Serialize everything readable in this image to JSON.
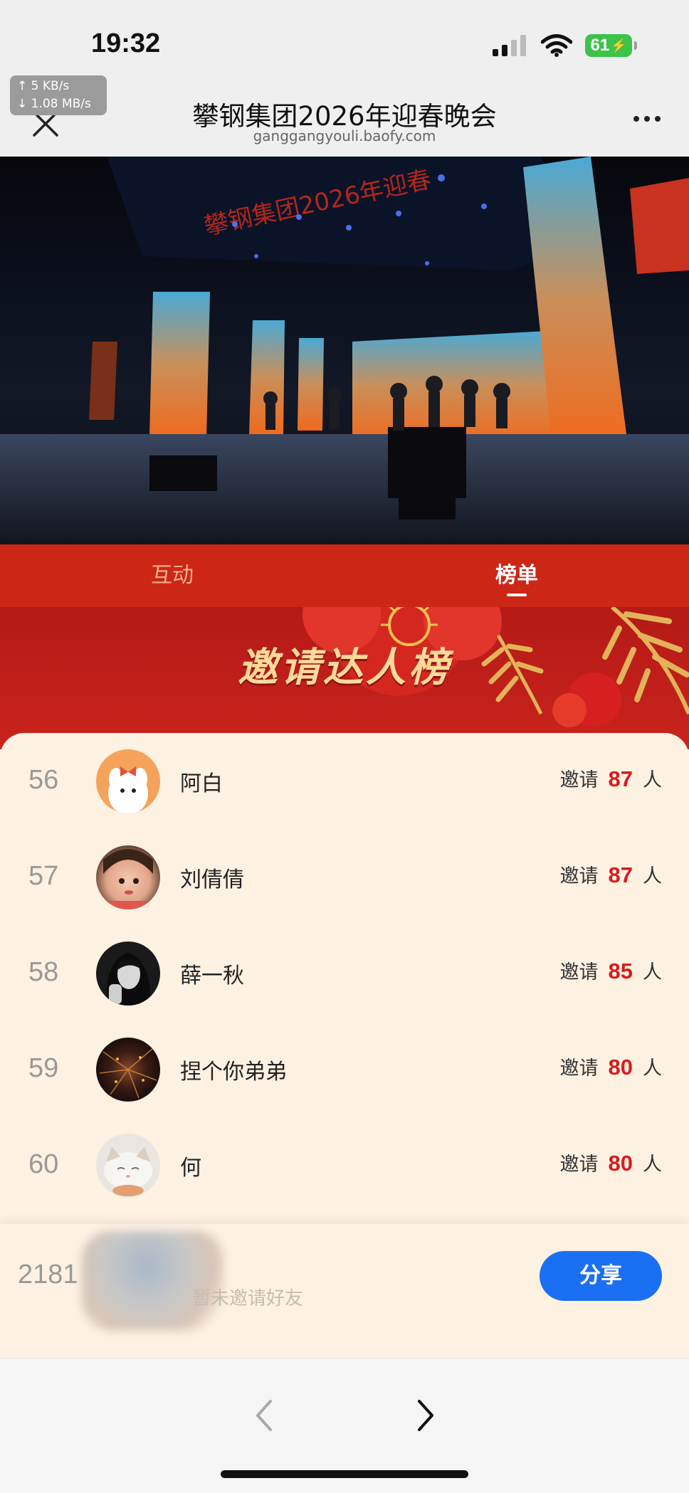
{
  "status_bar": {
    "time": "19:32",
    "battery": "61"
  },
  "net_speed": {
    "up": "↑ 5 KB/s",
    "down": "↓ 1.08 MB/s"
  },
  "nav": {
    "title": "攀钢集团2026年迎春晚会",
    "url": "ganggangyouli.baofy.com"
  },
  "video": {
    "screen_title": "攀钢集团2026年迎春"
  },
  "tabs": [
    {
      "label": "互动",
      "active": false
    },
    {
      "label": "榜单",
      "active": true
    }
  ],
  "banner": {
    "title": "邀请达人榜"
  },
  "leaderboard": {
    "invite_prefix": "邀请",
    "invite_suffix": "人",
    "rows": [
      {
        "rank": "56",
        "name": "阿白",
        "count": "87"
      },
      {
        "rank": "57",
        "name": "刘倩倩",
        "count": "87"
      },
      {
        "rank": "58",
        "name": "薛一秋",
        "count": "85"
      },
      {
        "rank": "59",
        "name": "捏个你弟弟",
        "count": "80"
      },
      {
        "rank": "60",
        "name": "何",
        "count": "80"
      }
    ]
  },
  "my_entry": {
    "rank": "2181",
    "hint": "暂未邀请好友",
    "share_label": "分享"
  },
  "colors": {
    "tab_bg": "#cc2617",
    "panel_bg": "#fdf1e1",
    "count_red": "#d81c1c",
    "share_blue": "#1b6ff2"
  },
  "icons": {
    "close": "close-icon",
    "more": "more-icon",
    "back": "chevron-left-icon",
    "forward": "chevron-right-icon"
  }
}
